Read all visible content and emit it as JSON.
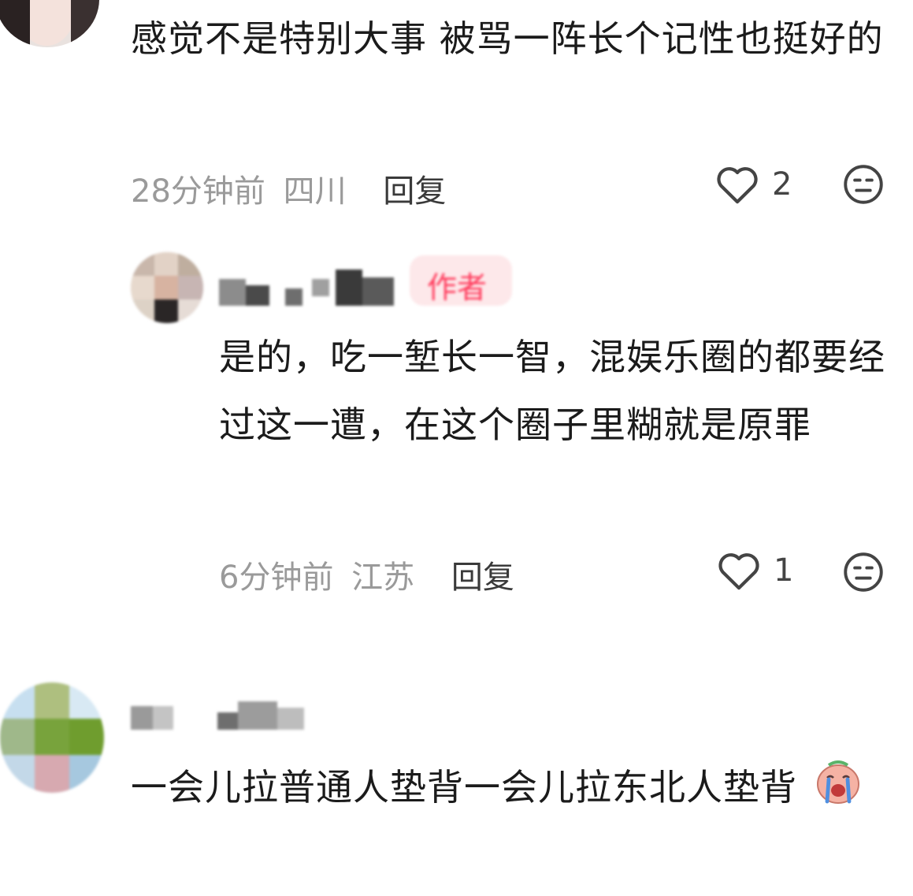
{
  "comments": [
    {
      "text": "感觉不是特别大事 被骂一阵长个记性也挺好的",
      "time": "28分钟前",
      "location": "四川",
      "reply_label": "回复",
      "likes": "2"
    },
    {
      "author_badge": "作者",
      "text": "是的，吃一堑长一智，混娱乐圈的都要经过这一遭，在这个圈子里糊就是原罪",
      "time": "6分钟前",
      "location": "江苏",
      "reply_label": "回复",
      "likes": "1"
    },
    {
      "text": "一会儿拉普通人垫背一会儿拉东北人垫背",
      "emoji": "crying-face-icon"
    }
  ],
  "colors": {
    "text": "#1b1b1b",
    "meta": "#9a9a9a",
    "badge": "#ff3b5c",
    "icon": "#444444"
  }
}
